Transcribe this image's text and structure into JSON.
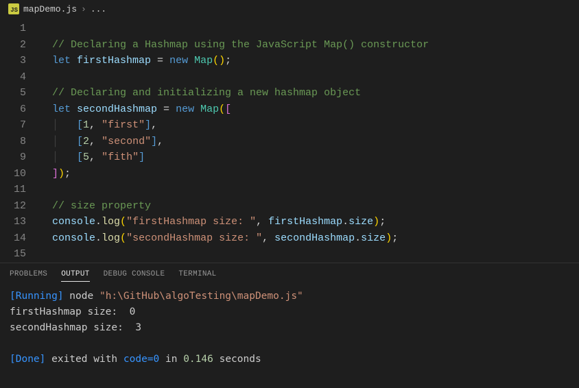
{
  "breadcrumb": {
    "icon_label": "JS",
    "filename": "mapDemo.js",
    "separator": "›",
    "ellipsis": "..."
  },
  "code": {
    "line1_num": "1",
    "line2_num": "2",
    "line2_comment": "// Declaring a Hashmap using the JavaScript Map() constructor",
    "line3_num": "3",
    "line3_let": "let ",
    "line3_var": "firstHashmap",
    "line3_eq": " = ",
    "line3_new": "new ",
    "line3_cls": "Map",
    "line3_paren": "()",
    "line3_semi": ";",
    "line4_num": "4",
    "line5_num": "5",
    "line5_comment": "// Declaring and initializing a new hashmap object",
    "line6_num": "6",
    "line6_let": "let ",
    "line6_var": "secondHashmap",
    "line6_eq": " = ",
    "line6_new": "new ",
    "line6_cls": "Map",
    "line6_paren_open": "(",
    "line6_brack_open": "[",
    "line7_num": "7",
    "line7_brack_open": "[",
    "line7_k": "1",
    "line7_comma": ", ",
    "line7_v": "\"first\"",
    "line7_brack_close": "]",
    "line7_tcomma": ",",
    "line8_num": "8",
    "line8_brack_open": "[",
    "line8_k": "2",
    "line8_comma": ", ",
    "line8_v": "\"second\"",
    "line8_brack_close": "]",
    "line8_tcomma": ",",
    "line9_num": "9",
    "line9_brack_open": "[",
    "line9_k": "5",
    "line9_comma": ", ",
    "line9_v": "\"fith\"",
    "line9_brack_close": "]",
    "line10_num": "10",
    "line10_brack_close": "]",
    "line10_paren_close": ")",
    "line10_semi": ";",
    "line11_num": "11",
    "line12_num": "12",
    "line12_comment": "// size property",
    "line13_num": "13",
    "line13_obj": "console",
    "line13_dot": ".",
    "line13_fn": "log",
    "line13_po": "(",
    "line13_str": "\"firstHashmap size: \"",
    "line13_comma": ", ",
    "line13_arg": "firstHashmap",
    "line13_dot2": ".",
    "line13_prop": "size",
    "line13_pc": ")",
    "line13_semi": ";",
    "line14_num": "14",
    "line14_obj": "console",
    "line14_dot": ".",
    "line14_fn": "log",
    "line14_po": "(",
    "line14_str": "\"secondHashmap size: \"",
    "line14_comma": ", ",
    "line14_arg": "secondHashmap",
    "line14_dot2": ".",
    "line14_prop": "size",
    "line14_pc": ")",
    "line14_semi": ";",
    "line15_num": "15"
  },
  "panel": {
    "tab_problems": "PROBLEMS",
    "tab_output": "OUTPUT",
    "tab_debug": "DEBUG CONSOLE",
    "tab_terminal": "TERMINAL"
  },
  "output": {
    "running_tag": "[Running]",
    "running_cmd": " node ",
    "running_path": "\"h:\\GitHub\\algoTesting\\mapDemo.js\"",
    "line1": "firstHashmap size:  0",
    "line2": "secondHashmap size:  3",
    "done_tag": "[Done]",
    "done_t1": " exited with ",
    "done_code": "code=0",
    "done_t2": " in ",
    "done_time": "0.146",
    "done_t3": " seconds"
  }
}
